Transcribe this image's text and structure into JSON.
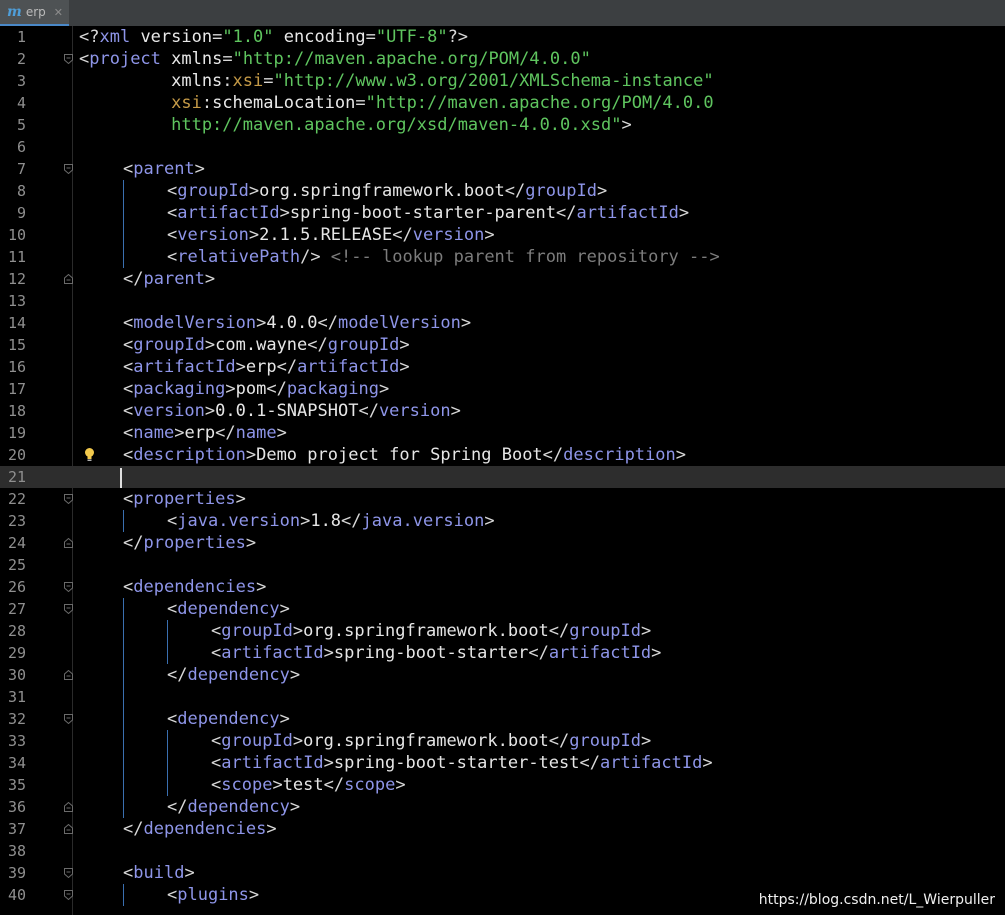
{
  "tab": {
    "label": "erp",
    "icon": "maven-icon",
    "close": "close-icon"
  },
  "lines": [
    {
      "n": "1",
      "indent": 0,
      "parts": [
        [
          "p",
          "<?"
        ],
        [
          "t",
          "xml"
        ],
        [
          "a",
          " version"
        ],
        [
          "p",
          "="
        ],
        [
          "v",
          "\"1.0\""
        ],
        [
          "a",
          " encoding"
        ],
        [
          "p",
          "="
        ],
        [
          "v",
          "\"UTF-8\""
        ],
        [
          "p",
          "?>"
        ]
      ]
    },
    {
      "n": "2",
      "indent": 0,
      "parts": [
        [
          "p",
          "<"
        ],
        [
          "t",
          "project"
        ],
        [
          "a",
          " xmlns"
        ],
        [
          "p",
          "="
        ],
        [
          "v",
          "\"http://maven.apache.org/POM/4.0.0\""
        ]
      ]
    },
    {
      "n": "3",
      "indent": 0,
      "parts": [
        [
          "a",
          "         xmlns"
        ],
        [
          "p",
          ":"
        ],
        [
          "ns",
          "xsi"
        ],
        [
          "p",
          "="
        ],
        [
          "v",
          "\"http://www.w3.org/2001/XMLSchema-instance\""
        ]
      ]
    },
    {
      "n": "4",
      "indent": 0,
      "parts": [
        [
          "ns",
          "         xsi"
        ],
        [
          "p",
          ":"
        ],
        [
          "a",
          "schemaLocation"
        ],
        [
          "p",
          "="
        ],
        [
          "v",
          "\"http://maven.apache.org/POM/4.0.0"
        ]
      ]
    },
    {
      "n": "5",
      "indent": 0,
      "parts": [
        [
          "v",
          "         http://maven.apache.org/xsd/maven-4.0.0.xsd\""
        ],
        [
          "p",
          ">"
        ]
      ]
    },
    {
      "n": "6",
      "indent": 0,
      "parts": []
    },
    {
      "n": "7",
      "indent": 1,
      "parts": [
        [
          "p",
          "<"
        ],
        [
          "t",
          "parent"
        ],
        [
          "p",
          ">"
        ]
      ]
    },
    {
      "n": "8",
      "indent": 2,
      "parts": [
        [
          "p",
          "<"
        ],
        [
          "t",
          "groupId"
        ],
        [
          "p",
          ">"
        ],
        [
          "x",
          "org.springframework.boot"
        ],
        [
          "p",
          "</"
        ],
        [
          "t",
          "groupId"
        ],
        [
          "p",
          ">"
        ]
      ]
    },
    {
      "n": "9",
      "indent": 2,
      "parts": [
        [
          "p",
          "<"
        ],
        [
          "t",
          "artifactId"
        ],
        [
          "p",
          ">"
        ],
        [
          "x",
          "spring-boot-starter-parent"
        ],
        [
          "p",
          "</"
        ],
        [
          "t",
          "artifactId"
        ],
        [
          "p",
          ">"
        ]
      ]
    },
    {
      "n": "10",
      "indent": 2,
      "parts": [
        [
          "p",
          "<"
        ],
        [
          "t",
          "version"
        ],
        [
          "p",
          ">"
        ],
        [
          "x",
          "2.1.5.RELEASE"
        ],
        [
          "p",
          "</"
        ],
        [
          "t",
          "version"
        ],
        [
          "p",
          ">"
        ]
      ]
    },
    {
      "n": "11",
      "indent": 2,
      "parts": [
        [
          "p",
          "<"
        ],
        [
          "t",
          "relativePath"
        ],
        [
          "p",
          "/> "
        ],
        [
          "c",
          "<!-- lookup parent from repository -->"
        ]
      ]
    },
    {
      "n": "12",
      "indent": 1,
      "parts": [
        [
          "p",
          "</"
        ],
        [
          "t",
          "parent"
        ],
        [
          "p",
          ">"
        ]
      ]
    },
    {
      "n": "13",
      "indent": 0,
      "parts": []
    },
    {
      "n": "14",
      "indent": 1,
      "parts": [
        [
          "p",
          "<"
        ],
        [
          "t",
          "modelVersion"
        ],
        [
          "p",
          ">"
        ],
        [
          "x",
          "4.0.0"
        ],
        [
          "p",
          "</"
        ],
        [
          "t",
          "modelVersion"
        ],
        [
          "p",
          ">"
        ]
      ]
    },
    {
      "n": "15",
      "indent": 1,
      "parts": [
        [
          "p",
          "<"
        ],
        [
          "t",
          "groupId"
        ],
        [
          "p",
          ">"
        ],
        [
          "x",
          "com.wayne"
        ],
        [
          "p",
          "</"
        ],
        [
          "t",
          "groupId"
        ],
        [
          "p",
          ">"
        ]
      ]
    },
    {
      "n": "16",
      "indent": 1,
      "parts": [
        [
          "p",
          "<"
        ],
        [
          "t",
          "artifactId"
        ],
        [
          "p",
          ">"
        ],
        [
          "x",
          "erp"
        ],
        [
          "p",
          "</"
        ],
        [
          "t",
          "artifactId"
        ],
        [
          "p",
          ">"
        ]
      ]
    },
    {
      "n": "17",
      "indent": 1,
      "parts": [
        [
          "p",
          "<"
        ],
        [
          "t",
          "packaging"
        ],
        [
          "p",
          ">"
        ],
        [
          "x",
          "pom"
        ],
        [
          "p",
          "</"
        ],
        [
          "t",
          "packaging"
        ],
        [
          "p",
          ">"
        ]
      ]
    },
    {
      "n": "18",
      "indent": 1,
      "parts": [
        [
          "p",
          "<"
        ],
        [
          "t",
          "version"
        ],
        [
          "p",
          ">"
        ],
        [
          "x",
          "0.0.1-SNAPSHOT"
        ],
        [
          "p",
          "</"
        ],
        [
          "t",
          "version"
        ],
        [
          "p",
          ">"
        ]
      ]
    },
    {
      "n": "19",
      "indent": 1,
      "parts": [
        [
          "p",
          "<"
        ],
        [
          "t",
          "name"
        ],
        [
          "p",
          ">"
        ],
        [
          "x",
          "erp"
        ],
        [
          "p",
          "</"
        ],
        [
          "t",
          "name"
        ],
        [
          "p",
          ">"
        ]
      ]
    },
    {
      "n": "20",
      "indent": 1,
      "parts": [
        [
          "p",
          "<"
        ],
        [
          "t",
          "description"
        ],
        [
          "p",
          ">"
        ],
        [
          "x",
          "Demo project for Spring Boot"
        ],
        [
          "p",
          "</"
        ],
        [
          "t",
          "description"
        ],
        [
          "p",
          ">"
        ]
      ]
    },
    {
      "n": "21",
      "indent": 1,
      "parts": []
    },
    {
      "n": "22",
      "indent": 1,
      "parts": [
        [
          "p",
          "<"
        ],
        [
          "t",
          "properties"
        ],
        [
          "p",
          ">"
        ]
      ]
    },
    {
      "n": "23",
      "indent": 2,
      "parts": [
        [
          "p",
          "<"
        ],
        [
          "t",
          "java.version"
        ],
        [
          "p",
          ">"
        ],
        [
          "x",
          "1.8"
        ],
        [
          "p",
          "</"
        ],
        [
          "t",
          "java.version"
        ],
        [
          "p",
          ">"
        ]
      ]
    },
    {
      "n": "24",
      "indent": 1,
      "parts": [
        [
          "p",
          "</"
        ],
        [
          "t",
          "properties"
        ],
        [
          "p",
          ">"
        ]
      ]
    },
    {
      "n": "25",
      "indent": 0,
      "parts": []
    },
    {
      "n": "26",
      "indent": 1,
      "parts": [
        [
          "p",
          "<"
        ],
        [
          "t",
          "dependencies"
        ],
        [
          "p",
          ">"
        ]
      ]
    },
    {
      "n": "27",
      "indent": 2,
      "parts": [
        [
          "p",
          "<"
        ],
        [
          "t",
          "dependency"
        ],
        [
          "p",
          ">"
        ]
      ]
    },
    {
      "n": "28",
      "indent": 3,
      "parts": [
        [
          "p",
          "<"
        ],
        [
          "t",
          "groupId"
        ],
        [
          "p",
          ">"
        ],
        [
          "x",
          "org.springframework.boot"
        ],
        [
          "p",
          "</"
        ],
        [
          "t",
          "groupId"
        ],
        [
          "p",
          ">"
        ]
      ]
    },
    {
      "n": "29",
      "indent": 3,
      "parts": [
        [
          "p",
          "<"
        ],
        [
          "t",
          "artifactId"
        ],
        [
          "p",
          ">"
        ],
        [
          "x",
          "spring-boot-starter"
        ],
        [
          "p",
          "</"
        ],
        [
          "t",
          "artifactId"
        ],
        [
          "p",
          ">"
        ]
      ]
    },
    {
      "n": "30",
      "indent": 2,
      "parts": [
        [
          "p",
          "</"
        ],
        [
          "t",
          "dependency"
        ],
        [
          "p",
          ">"
        ]
      ]
    },
    {
      "n": "31",
      "indent": 0,
      "parts": []
    },
    {
      "n": "32",
      "indent": 2,
      "parts": [
        [
          "p",
          "<"
        ],
        [
          "t",
          "dependency"
        ],
        [
          "p",
          ">"
        ]
      ]
    },
    {
      "n": "33",
      "indent": 3,
      "parts": [
        [
          "p",
          "<"
        ],
        [
          "t",
          "groupId"
        ],
        [
          "p",
          ">"
        ],
        [
          "x",
          "org.springframework.boot"
        ],
        [
          "p",
          "</"
        ],
        [
          "t",
          "groupId"
        ],
        [
          "p",
          ">"
        ]
      ]
    },
    {
      "n": "34",
      "indent": 3,
      "parts": [
        [
          "p",
          "<"
        ],
        [
          "t",
          "artifactId"
        ],
        [
          "p",
          ">"
        ],
        [
          "x",
          "spring-boot-starter-test"
        ],
        [
          "p",
          "</"
        ],
        [
          "t",
          "artifactId"
        ],
        [
          "p",
          ">"
        ]
      ]
    },
    {
      "n": "35",
      "indent": 3,
      "parts": [
        [
          "p",
          "<"
        ],
        [
          "t",
          "scope"
        ],
        [
          "p",
          ">"
        ],
        [
          "x",
          "test"
        ],
        [
          "p",
          "</"
        ],
        [
          "t",
          "scope"
        ],
        [
          "p",
          ">"
        ]
      ]
    },
    {
      "n": "36",
      "indent": 2,
      "parts": [
        [
          "p",
          "</"
        ],
        [
          "t",
          "dependency"
        ],
        [
          "p",
          ">"
        ]
      ]
    },
    {
      "n": "37",
      "indent": 1,
      "parts": [
        [
          "p",
          "</"
        ],
        [
          "t",
          "dependencies"
        ],
        [
          "p",
          ">"
        ]
      ]
    },
    {
      "n": "38",
      "indent": 0,
      "parts": []
    },
    {
      "n": "39",
      "indent": 1,
      "parts": [
        [
          "p",
          "<"
        ],
        [
          "t",
          "build"
        ],
        [
          "p",
          ">"
        ]
      ]
    },
    {
      "n": "40",
      "indent": 2,
      "parts": [
        [
          "p",
          "<"
        ],
        [
          "t",
          "plugins"
        ],
        [
          "p",
          ">"
        ]
      ]
    }
  ],
  "current_line": "21",
  "folds": [
    {
      "line": "2",
      "kind": "open"
    },
    {
      "line": "7",
      "kind": "open"
    },
    {
      "line": "12",
      "kind": "close"
    },
    {
      "line": "22",
      "kind": "open"
    },
    {
      "line": "24",
      "kind": "close"
    },
    {
      "line": "26",
      "kind": "open"
    },
    {
      "line": "27",
      "kind": "open"
    },
    {
      "line": "30",
      "kind": "close"
    },
    {
      "line": "32",
      "kind": "open"
    },
    {
      "line": "36",
      "kind": "close"
    },
    {
      "line": "37",
      "kind": "close"
    },
    {
      "line": "39",
      "kind": "open"
    },
    {
      "line": "40",
      "kind": "open"
    }
  ],
  "bulb_line": "20",
  "watermark": "https://blog.csdn.net/L_Wierpuller",
  "colors": {
    "background": "#000000",
    "tag": "#8e95e8",
    "value": "#5fc55f",
    "namespace": "#c59a47",
    "comment": "#7c7c7c",
    "guide": "#3a6fb0"
  }
}
